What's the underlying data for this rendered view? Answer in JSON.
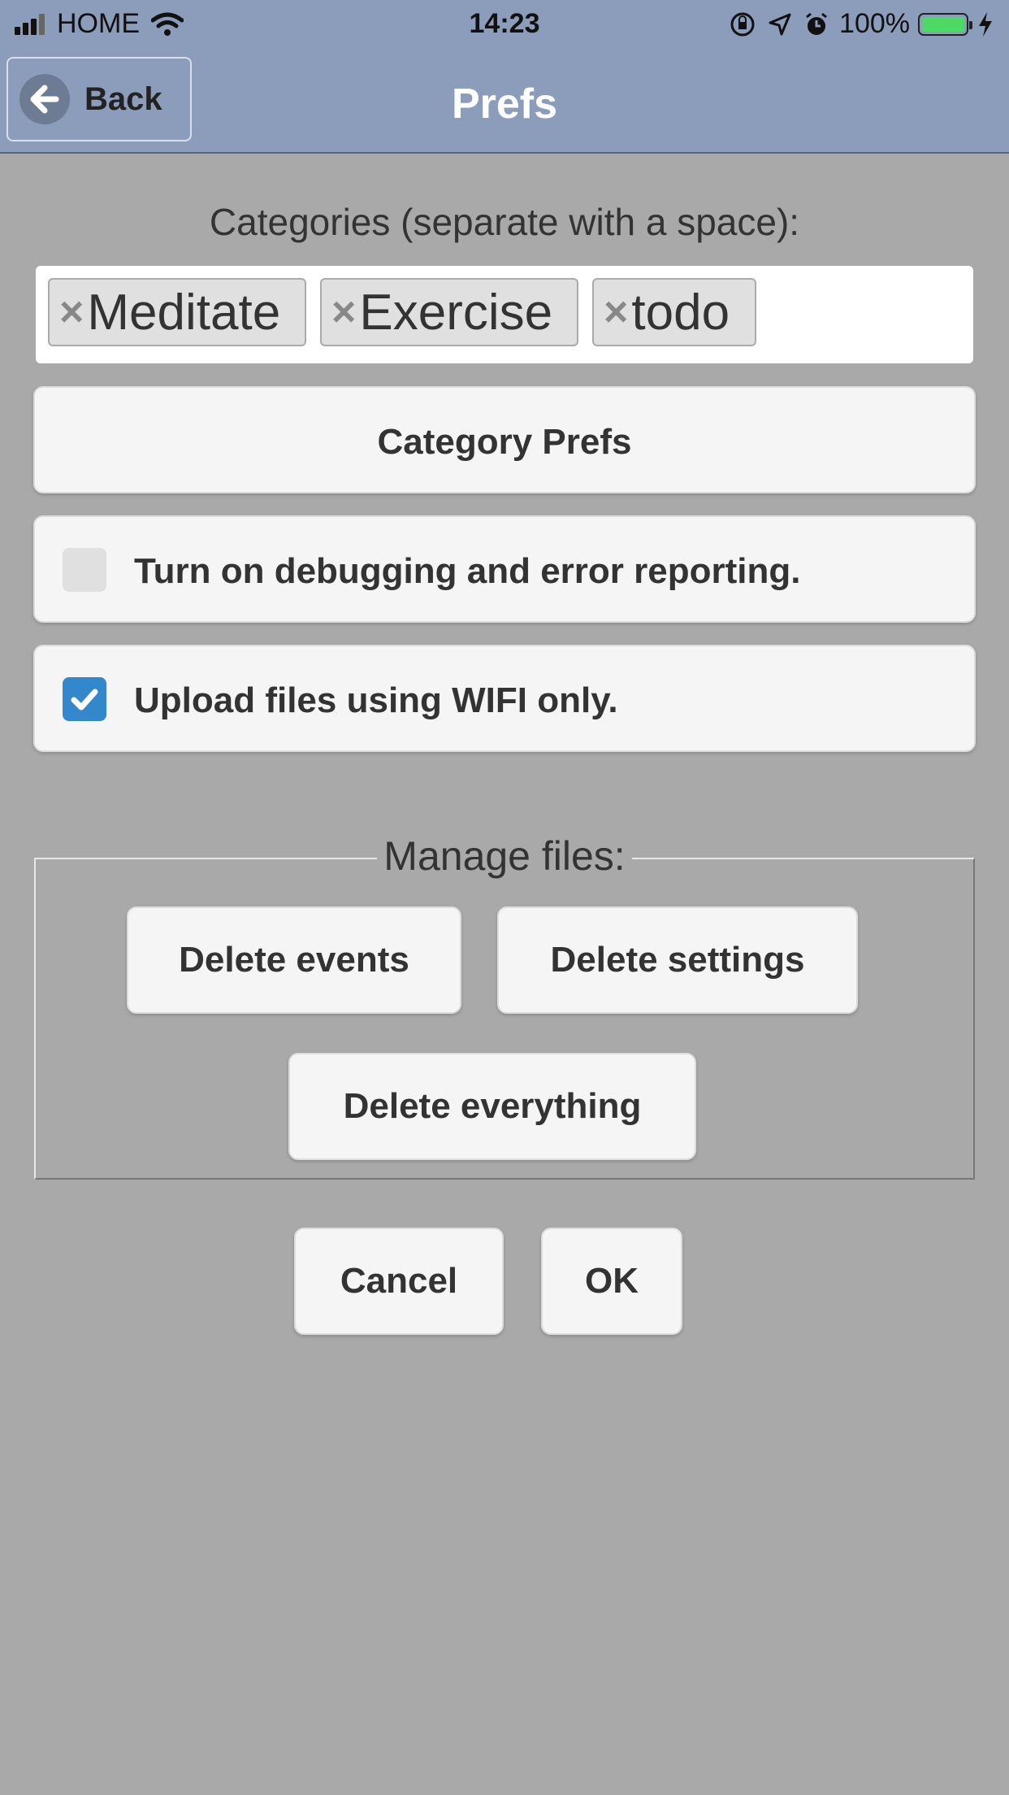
{
  "status_bar": {
    "carrier": "HOME",
    "time": "14:23",
    "battery_percent": "100%",
    "battery_color": "#4cd964",
    "icons": [
      "signal-icon",
      "wifi-icon",
      "orientation-lock-icon",
      "location-icon",
      "alarm-icon",
      "battery-icon",
      "charging-icon"
    ]
  },
  "header": {
    "back_label": "Back",
    "title": "Prefs",
    "color": "#8c9dbb"
  },
  "categories": {
    "label": "Categories (separate with a space):",
    "tags": [
      "Meditate",
      "Exercise",
      "todo"
    ],
    "remove_glyph": "×"
  },
  "category_prefs_label": "Category Prefs",
  "debug_option": {
    "label": "Turn on debugging and error reporting.",
    "checked": false
  },
  "wifi_option": {
    "label": "Upload files using WIFI only.",
    "checked": true,
    "check_color": "#3388cc"
  },
  "manage_files": {
    "legend": "Manage files:",
    "delete_events": "Delete events",
    "delete_settings": "Delete settings",
    "delete_everything": "Delete everything"
  },
  "actions": {
    "cancel": "Cancel",
    "ok": "OK"
  }
}
